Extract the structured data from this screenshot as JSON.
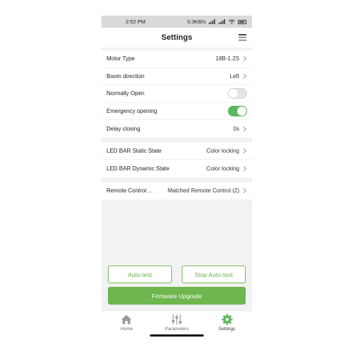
{
  "status_bar": {
    "time": "2:52 PM",
    "net_speed": "0.3KB/s"
  },
  "header": {
    "title": "Settings"
  },
  "groups": [
    {
      "rows": [
        {
          "label": "Motor Type",
          "value": "18B-1.2S"
        },
        {
          "label": "Boom direction",
          "value": "Left"
        },
        {
          "label": "Normally Open",
          "toggle": "off"
        },
        {
          "label": "Emergency opening",
          "toggle": "on"
        },
        {
          "label": "Delay closing",
          "value": "0s"
        }
      ]
    },
    {
      "rows": [
        {
          "label": "LED BAR Static State",
          "value": "Color locking"
        },
        {
          "label": "LED BAR Dynamic State",
          "value": "Color locking"
        }
      ]
    },
    {
      "rows": [
        {
          "label": "Remote Control ...",
          "value": "Matched Remote Control (2)"
        }
      ]
    }
  ],
  "buttons": {
    "auto_test": "Auto-test",
    "stop_auto_test": "Stop Auto-test",
    "firmware_upgrade": "Firmware Upgrade"
  },
  "tabs": [
    {
      "label": "Home",
      "icon": "home-icon"
    },
    {
      "label": "Parameters",
      "icon": "sliders-icon"
    },
    {
      "label": "Settings",
      "icon": "gear-icon",
      "active": true
    }
  ],
  "colors": {
    "accent": "#6fb64f",
    "toggle_on": "#5cb85c",
    "background": "#f2f2f2"
  }
}
